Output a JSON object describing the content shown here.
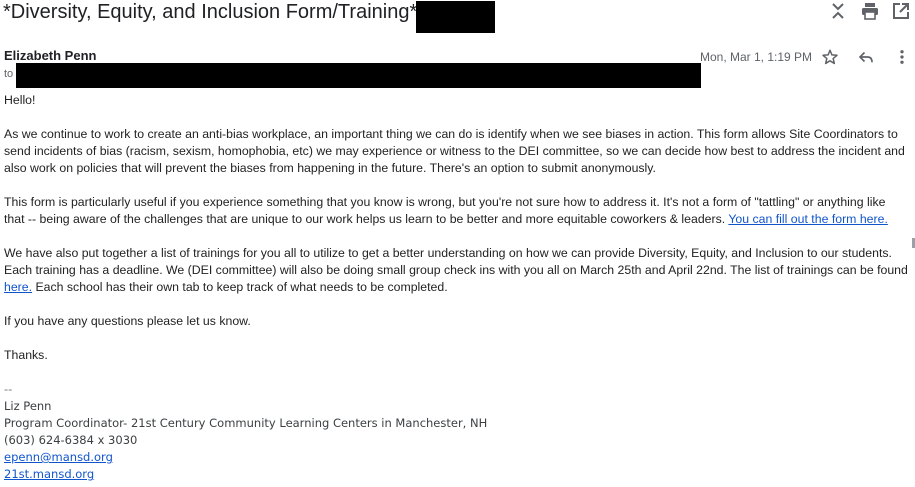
{
  "email": {
    "subject": "*Diversity, Equity, and Inclusion Form/Training*",
    "sender": "Elizabeth Penn",
    "to_label": "to",
    "date": "Mon, Mar 1, 1:19 PM"
  },
  "toolbar": {
    "icons": [
      "collapse-icon",
      "print-icon",
      "open-in-new-window-icon"
    ]
  },
  "actions": {
    "icons": [
      "star-icon",
      "reply-icon",
      "more-options-icon"
    ]
  },
  "body": {
    "greeting": "Hello!",
    "p1": "As we continue to work to create an anti-bias workplace, an important thing we can do is identify when we see biases in action. This form allows Site Coordinators to send incidents of bias (racism, sexism, homophobia, etc) we may experience or witness to the DEI committee, so we can decide how best to address the incident and also work on policies that will prevent the biases from happening in the future. There's an option to submit anonymously.",
    "p2_text": "This form is particularly useful if you experience something that you know is wrong, but you're not sure how to address it. It's not a form of \"tattling\" or anything like that -- being aware of the challenges that are unique to our work helps us learn to be better and more equitable coworkers & leaders. ",
    "p2_link": "You can fill out the form here.",
    "p3_text_a": "We have also put together a list of trainings for you all to utilize to get a better understanding on how we can provide Diversity, Equity, and Inclusion to our students. Each training has a deadline. We (DEI committee) will also be doing small group check ins with you all on March 25th and April 22nd. The list of trainings can be found ",
    "p3_link": "here.",
    "p3_text_b": " Each school has their own tab to keep track of what needs to be completed.",
    "p4": "If you have any questions please let us know.",
    "closing": "Thanks."
  },
  "signature": {
    "dashes": "--",
    "name": "Liz Penn",
    "title": "Program Coordinator- 21st Century Community Learning Centers in Manchester, NH",
    "phone": "(603) 624-6384 x 3030",
    "email": "epenn@mansd.org",
    "website": "21st.mansd.org"
  }
}
